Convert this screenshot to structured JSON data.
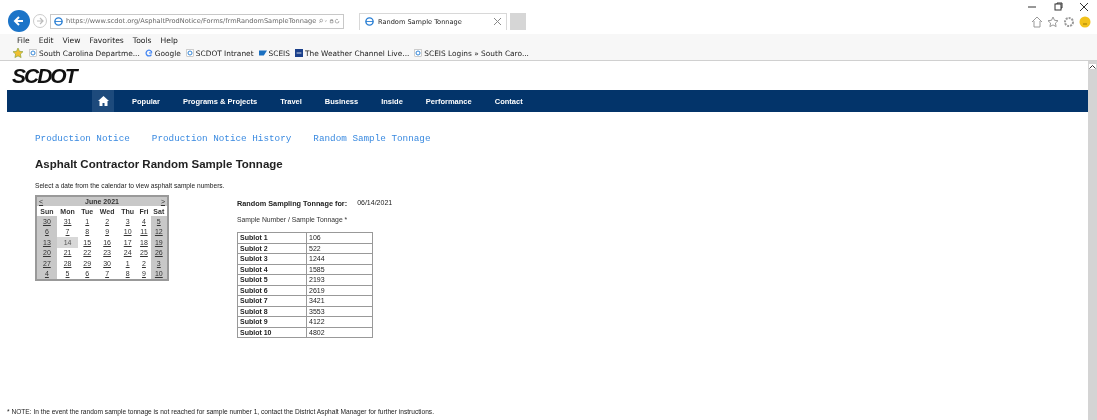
{
  "browser": {
    "url": "https://www.scdot.org/AsphaltProdNotice/Forms/frmRandomSampleTonnage",
    "tab_title": "Random Sample Tonnage",
    "menu": [
      "File",
      "Edit",
      "View",
      "Favorites",
      "Tools",
      "Help"
    ],
    "favorites": [
      {
        "label": "South Carolina Departme...",
        "kind": "ie"
      },
      {
        "label": "Google",
        "kind": "google"
      },
      {
        "label": "SCDOT Intranet",
        "kind": "ie"
      },
      {
        "label": "SCEIS",
        "kind": "sap"
      },
      {
        "label": "The Weather Channel Live...",
        "kind": "twc"
      },
      {
        "label": "SCEIS Logins » South Caro...",
        "kind": "ie"
      }
    ]
  },
  "site": {
    "logo": "SCDOT",
    "nav": [
      "Popular",
      "Programs & Projects",
      "Travel",
      "Business",
      "Inside",
      "Performance",
      "Contact"
    ]
  },
  "links": [
    "Production Notice",
    "Production Notice History",
    "Random Sample Tonnage"
  ],
  "heading": "Asphalt Contractor Random Sample Tonnage",
  "instruction": "Select a date from the calendar to view asphalt sample numbers.",
  "calendar": {
    "prev": "<",
    "title": "June 2021",
    "next": ">",
    "weekdays": [
      "Sun",
      "Mon",
      "Tue",
      "Wed",
      "Thu",
      "Fri",
      "Sat"
    ],
    "weeks": [
      [
        {
          "label": "30",
          "selected": false
        },
        {
          "label": "31",
          "selected": false
        },
        {
          "label": "1",
          "selected": false
        },
        {
          "label": "2",
          "selected": false
        },
        {
          "label": "3",
          "selected": false
        },
        {
          "label": "4",
          "selected": false
        },
        {
          "label": "5",
          "selected": false
        }
      ],
      [
        {
          "label": "6",
          "selected": false
        },
        {
          "label": "7",
          "selected": false
        },
        {
          "label": "8",
          "selected": false
        },
        {
          "label": "9",
          "selected": false
        },
        {
          "label": "10",
          "selected": false
        },
        {
          "label": "11",
          "selected": false
        },
        {
          "label": "12",
          "selected": false
        }
      ],
      [
        {
          "label": "13",
          "selected": false
        },
        {
          "label": "14",
          "selected": true
        },
        {
          "label": "15",
          "selected": false
        },
        {
          "label": "16",
          "selected": false
        },
        {
          "label": "17",
          "selected": false
        },
        {
          "label": "18",
          "selected": false
        },
        {
          "label": "19",
          "selected": false
        }
      ],
      [
        {
          "label": "20",
          "selected": false
        },
        {
          "label": "21",
          "selected": false
        },
        {
          "label": "22",
          "selected": false
        },
        {
          "label": "23",
          "selected": false
        },
        {
          "label": "24",
          "selected": false
        },
        {
          "label": "25",
          "selected": false
        },
        {
          "label": "26",
          "selected": false
        }
      ],
      [
        {
          "label": "27",
          "selected": false
        },
        {
          "label": "28",
          "selected": false
        },
        {
          "label": "29",
          "selected": false
        },
        {
          "label": "30",
          "selected": false
        },
        {
          "label": "1",
          "selected": false
        },
        {
          "label": "2",
          "selected": false
        },
        {
          "label": "3",
          "selected": false
        }
      ],
      [
        {
          "label": "4",
          "selected": false
        },
        {
          "label": "5",
          "selected": false
        },
        {
          "label": "6",
          "selected": false
        },
        {
          "label": "7",
          "selected": false
        },
        {
          "label": "8",
          "selected": false
        },
        {
          "label": "9",
          "selected": false
        },
        {
          "label": "10",
          "selected": false
        }
      ]
    ]
  },
  "result": {
    "label": "Random Sampling Tonnage for:",
    "date": "06/14/2021",
    "subtitle": "Sample Number / Sample Tonnage *",
    "rows": [
      {
        "sublot": "Sublot 1",
        "tonnage": "106"
      },
      {
        "sublot": "Sublot 2",
        "tonnage": "522"
      },
      {
        "sublot": "Sublot 3",
        "tonnage": "1244"
      },
      {
        "sublot": "Sublot 4",
        "tonnage": "1585"
      },
      {
        "sublot": "Sublot 5",
        "tonnage": "2193"
      },
      {
        "sublot": "Sublot 6",
        "tonnage": "2619"
      },
      {
        "sublot": "Sublot 7",
        "tonnage": "3421"
      },
      {
        "sublot": "Sublot 8",
        "tonnage": "3553"
      },
      {
        "sublot": "Sublot 9",
        "tonnage": "4122"
      },
      {
        "sublot": "Sublot 10",
        "tonnage": "4802"
      }
    ]
  },
  "note": "* NOTE: In the event the random sample tonnage is not reached for sample number 1, contact the District Asphalt Manager for further instructions."
}
